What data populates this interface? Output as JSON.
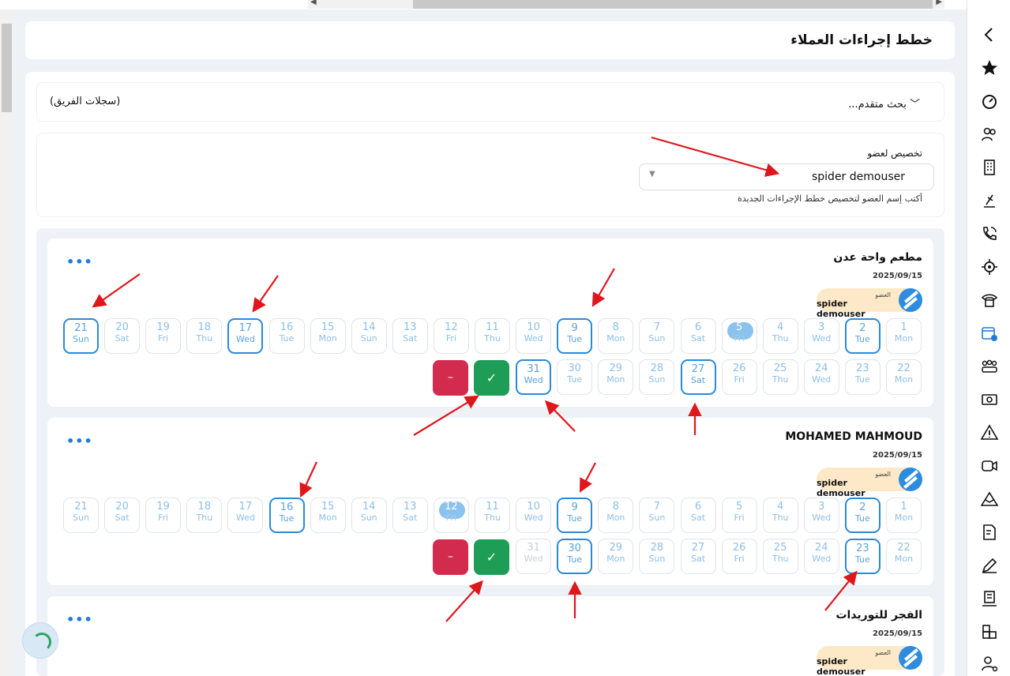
{
  "page_title": "خطط إجراءات العملاء",
  "filters": {
    "advanced_search": "بحث متقدم...",
    "team_records": "(سجلات الفريق)"
  },
  "assign": {
    "label": "تخصيص لعضو",
    "selected": "spider demouser",
    "hint": "أكتب إسم العضو لتخصيص خطط الإجراءات الجديدة"
  },
  "clients": [
    {
      "name": "مطعم واحة عدن",
      "date": "2025/09/15",
      "member_role": "العضو",
      "member_name": "spider demouser",
      "menu": "•••",
      "approve": "✓",
      "reject": "–",
      "selected_days": [
        2,
        9,
        17,
        21,
        27,
        31
      ],
      "today": 5
    },
    {
      "name": "MOHAMED MAHMOUD",
      "date": "2025/09/15",
      "member_role": "العضو",
      "member_name": "spider demouser",
      "menu": "•••",
      "approve": "✓",
      "reject": "–",
      "selected_days": [
        2,
        9,
        16,
        23,
        30
      ],
      "today": 12
    },
    {
      "name": "الفجر للتوريدات",
      "date": "2025/09/15",
      "member_role": "العضو",
      "member_name": "spider demouser",
      "menu": "•••"
    }
  ],
  "day_names": [
    "Mon",
    "Tue",
    "Wed",
    "Thu",
    "Fri",
    "Sat",
    "Sun"
  ],
  "sidebar_icons": [
    "chevron-left-icon",
    "star-icon",
    "dashboard-icon",
    "users-icon",
    "building-icon",
    "worker-icon",
    "phone-call-icon",
    "target-icon",
    "telephone-icon",
    "calendar-settings-icon",
    "team-icon",
    "money-icon",
    "warning-icon",
    "video-call-icon",
    "mountain-icon",
    "invoice-icon",
    "signature-icon",
    "inventory-icon",
    "boxes-icon",
    "user-settings-icon"
  ],
  "colors": {
    "selected_border": "#2b8ad8",
    "approve": "#1d9d55",
    "reject": "#d32b4e",
    "badge_bg": "#fde9c7",
    "annotation": "#e0161d"
  }
}
